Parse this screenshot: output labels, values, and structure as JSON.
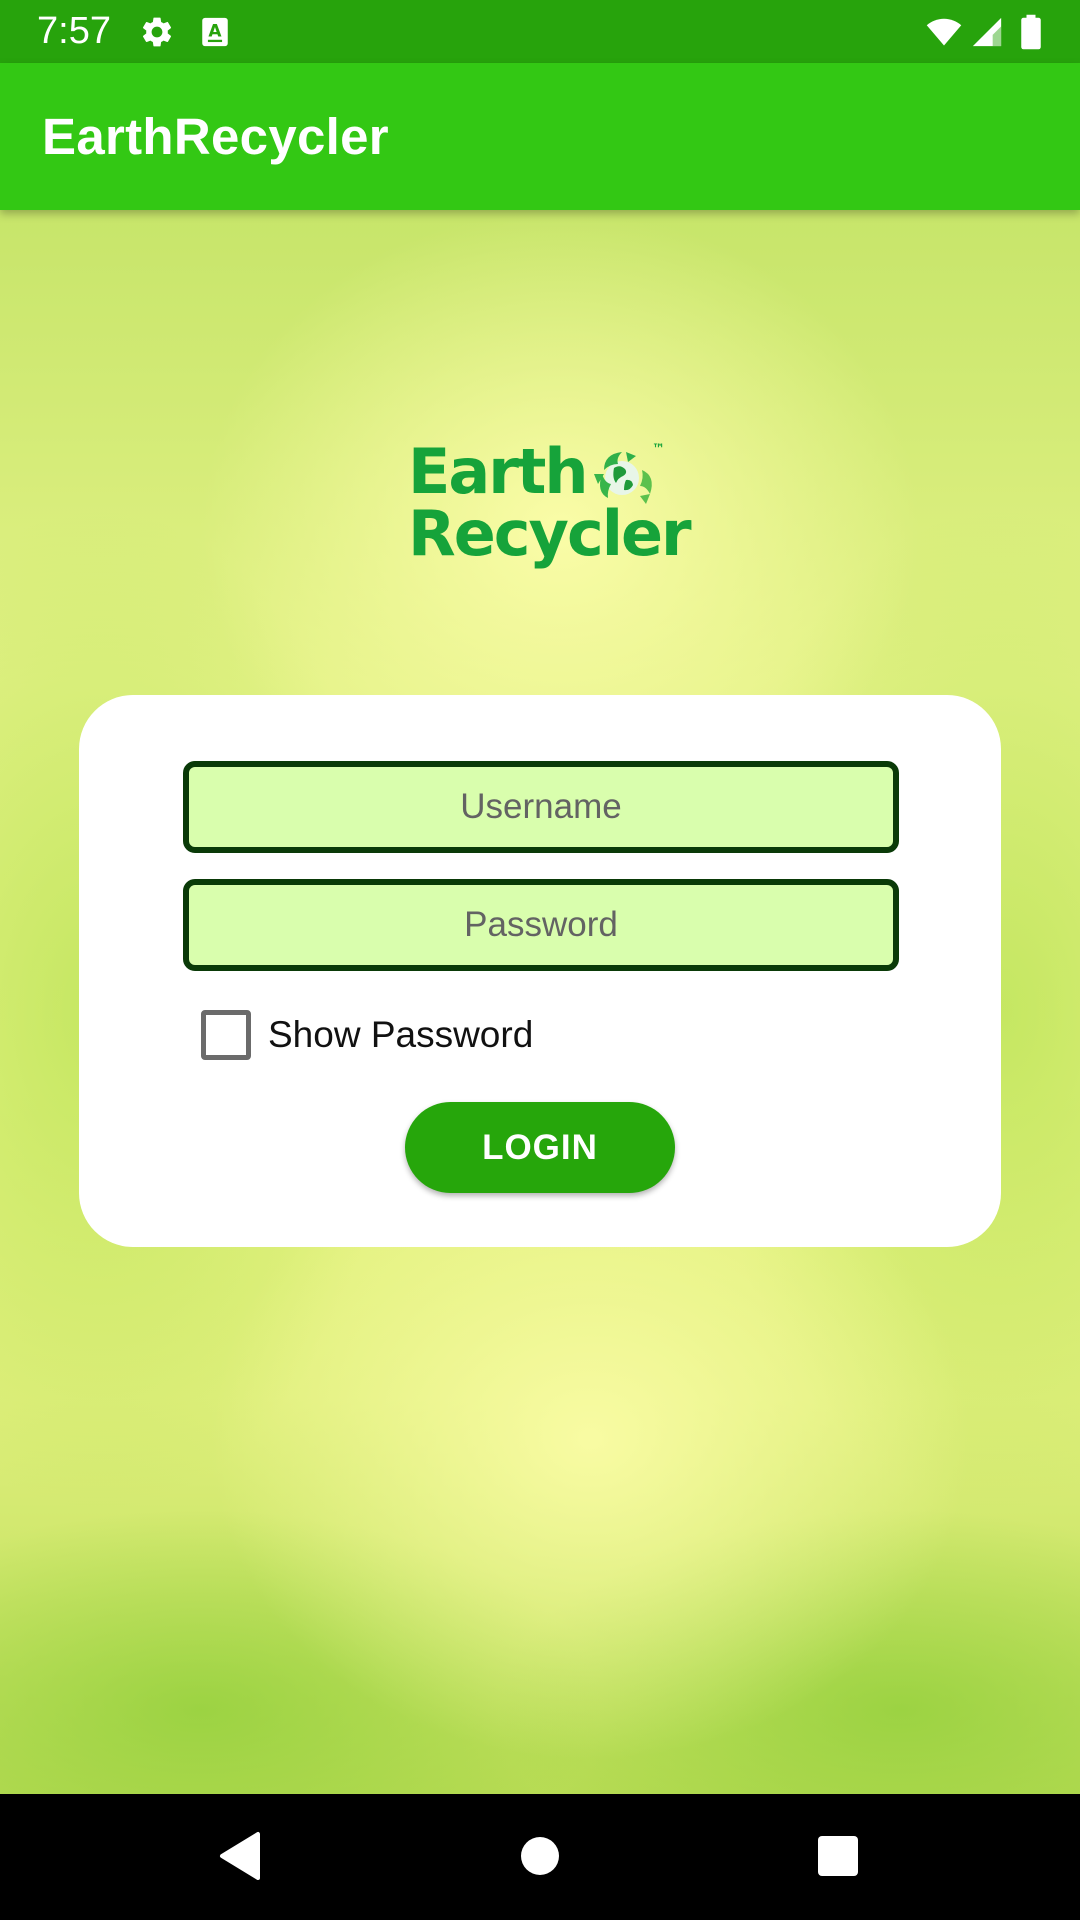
{
  "status_bar": {
    "time": "7:57",
    "icons": [
      "settings-icon",
      "keyboard-a-icon",
      "wifi-icon",
      "signal-icon",
      "battery-icon"
    ],
    "background": "#27a30c"
  },
  "app_bar": {
    "title": "EarthRecycler",
    "background": "#33c814"
  },
  "logo": {
    "line1": "Earth",
    "line2": "Recycler",
    "trademark": "™",
    "color": "#16a33a"
  },
  "login_form": {
    "username": {
      "placeholder": "Username",
      "value": ""
    },
    "password": {
      "placeholder": "Password",
      "value": ""
    },
    "show_password": {
      "label": "Show Password",
      "checked": false
    },
    "login_button": {
      "label": "LOGIN",
      "color": "#26a60b"
    },
    "field_background": "#d9fead",
    "field_border": "#0a3a08"
  },
  "nav_bar": {
    "buttons": [
      "back-icon",
      "home-icon",
      "recents-icon"
    ]
  }
}
